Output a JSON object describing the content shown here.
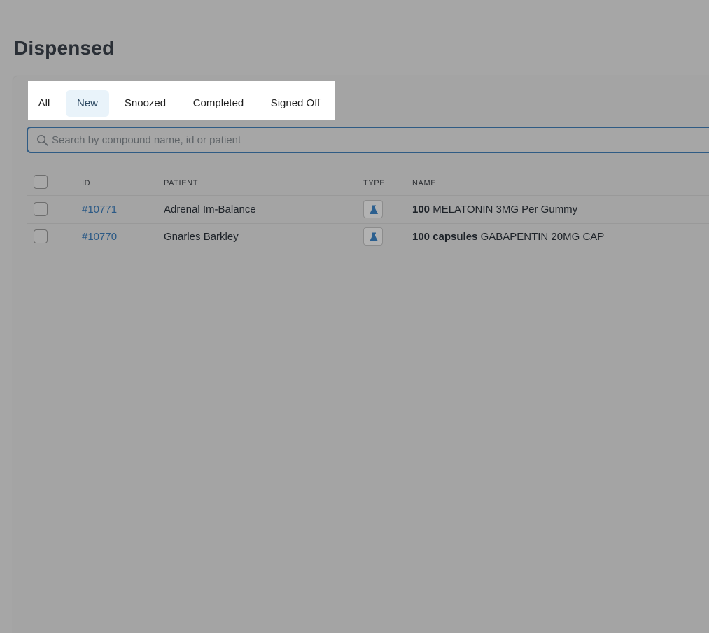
{
  "page": {
    "title": "Dispensed"
  },
  "tabs": [
    {
      "label": "All",
      "selected": false
    },
    {
      "label": "New",
      "selected": true
    },
    {
      "label": "Snoozed",
      "selected": false
    },
    {
      "label": "Completed",
      "selected": false
    },
    {
      "label": "Signed Off",
      "selected": false
    }
  ],
  "search": {
    "placeholder": "Search by compound name, id or patient",
    "value": "",
    "icon": "search-icon"
  },
  "table": {
    "columns": [
      "ID",
      "PATIENT",
      "TYPE",
      "NAME"
    ],
    "rows": [
      {
        "id": "#10771",
        "patient": "Adrenal Im-Balance",
        "type_icon": "flask-icon",
        "name_qty": "100",
        "name_rest": "MELATONIN 3MG Per Gummy"
      },
      {
        "id": "#10770",
        "patient": "Gnarles Barkley",
        "type_icon": "flask-icon",
        "name_qty": "100 capsules",
        "name_rest": "GABAPENTIN 20MG CAP"
      }
    ]
  },
  "colors": {
    "overlay_background": "#a6a6a6",
    "link": "#2c5a86",
    "search_border": "#2f5b84",
    "selected_tab_bg": "#e9f3fa",
    "flask_icon": "#2b5f8f"
  }
}
